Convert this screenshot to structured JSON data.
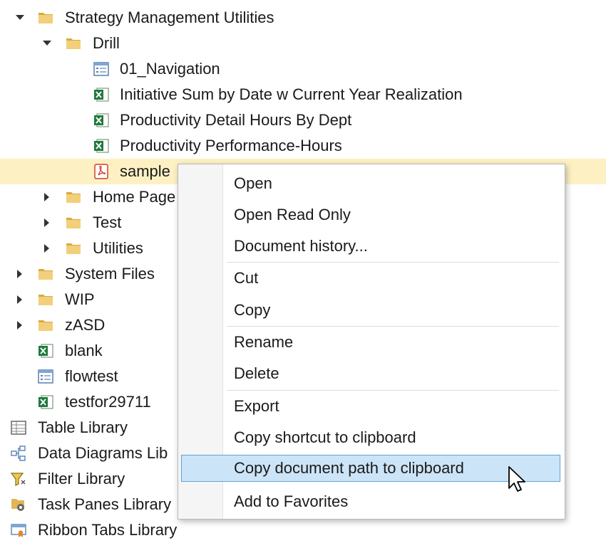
{
  "tree": {
    "strategy": "Strategy Management Utilities",
    "drill": "Drill",
    "nav": "01_Navigation",
    "init": "Initiative Sum by Date w Current Year Realization",
    "prodDetail": "Productivity Detail Hours By Dept",
    "prodPerf": "Productivity Performance-Hours",
    "sample": "sample",
    "home": "Home Page",
    "test": "Test",
    "utilities": "Utilities",
    "systemFiles": "System Files",
    "wip": "WIP",
    "zasd": "zASD",
    "blank": "blank",
    "flowtest": "flowtest",
    "testfor": "testfor29711",
    "tableLib": "Table Library",
    "dataDiag": "Data Diagrams Lib",
    "filterLib": "Filter Library",
    "taskPanes": "Task Panes Library",
    "ribbonTabs": "Ribbon Tabs Library"
  },
  "menu": {
    "open": "Open",
    "openRO": "Open Read Only",
    "history": "Document history...",
    "cut": "Cut",
    "copy": "Copy",
    "rename": "Rename",
    "delete": "Delete",
    "export": "Export",
    "copyShortcut": "Copy shortcut to clipboard",
    "copyPath": "Copy document path to clipboard",
    "favorites": "Add to Favorites"
  },
  "colors": {
    "selectedRow": "#fdf1c4",
    "menuHighlight": "#cce4f7",
    "menuHighlightBorder": "#5da3d9",
    "folder": "#e8c06a",
    "excel": "#1f7a3c",
    "pdf": "#d63a2f"
  }
}
